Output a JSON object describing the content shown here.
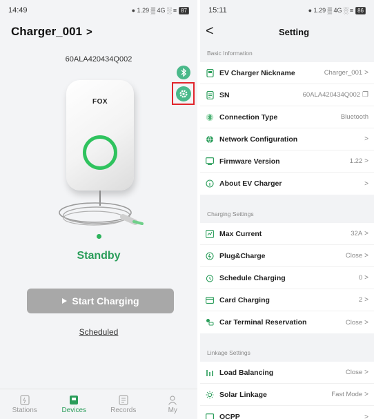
{
  "left": {
    "status_time": "14:49",
    "status_icons": "● 1.29 ▒ 4G ░ ≡",
    "battery": "87",
    "device_title": "Charger_001",
    "title_chevron": ">",
    "serial": "60ALA420434Q002",
    "charger_logo": "FOX",
    "state": "Standby",
    "start_label": "Start Charging",
    "scheduled_label": "Scheduled",
    "tabs": [
      {
        "label": "Stations",
        "icon": "station-icon"
      },
      {
        "label": "Devices",
        "icon": "device-icon"
      },
      {
        "label": "Records",
        "icon": "records-icon"
      },
      {
        "label": "My",
        "icon": "user-icon"
      }
    ],
    "accent": "#2a9d5a",
    "highlight": "#e1242b"
  },
  "right": {
    "status_time": "15:11",
    "status_icons": "● 1.29 ▒ 4G ░ ≡",
    "battery": "86",
    "nav_back": "<",
    "title": "Setting",
    "sections": [
      {
        "label": "Basic Information",
        "rows": [
          {
            "label": "EV Charger Nickname",
            "value": "Charger_001",
            "arrow": ">",
            "icon": "charger-icon"
          },
          {
            "label": "SN",
            "value": "60ALA420434Q002",
            "arrow": "❐",
            "icon": "sn-icon"
          },
          {
            "label": "Connection Type",
            "value": "Bluetooth",
            "arrow": "",
            "icon": "bluetooth-icon"
          },
          {
            "label": "Network Configuration",
            "value": "",
            "arrow": ">",
            "icon": "globe-icon"
          },
          {
            "label": "Firmware Version",
            "value": "1.22",
            "arrow": ">",
            "icon": "firmware-icon"
          },
          {
            "label": "About EV Charger",
            "value": "",
            "arrow": ">",
            "icon": "info-icon"
          }
        ]
      },
      {
        "label": "Charging Settings",
        "rows": [
          {
            "label": "Max Current",
            "value": "32A",
            "arrow": ">",
            "icon": "current-icon"
          },
          {
            "label": "Plug&Charge",
            "value": "Close",
            "arrow": ">",
            "icon": "plug-icon"
          },
          {
            "label": "Schedule Charging",
            "value": "0",
            "arrow": ">",
            "icon": "clock-icon"
          },
          {
            "label": "Card Charging",
            "value": "2",
            "arrow": ">",
            "icon": "card-icon"
          },
          {
            "label": "Car Terminal Reservation",
            "value": "Close",
            "arrow": ">",
            "icon": "car-icon"
          }
        ]
      },
      {
        "label": "Linkage Settings",
        "rows": [
          {
            "label": "Load Balancing",
            "value": "Close",
            "arrow": ">",
            "icon": "balance-icon"
          },
          {
            "label": "Solar Linkage",
            "value": "Fast Mode",
            "arrow": ">",
            "icon": "sun-icon"
          },
          {
            "label": "OCPP",
            "value": "",
            "arrow": ">",
            "icon": "ocpp-icon"
          }
        ]
      }
    ]
  }
}
